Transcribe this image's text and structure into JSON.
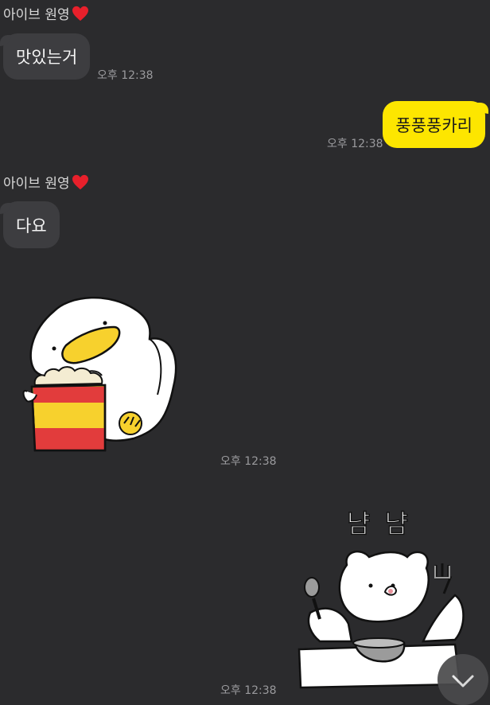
{
  "messages": [
    {
      "sender": "아이브 원영",
      "text": "맛있는거",
      "time": "오후 12:38"
    },
    {
      "text": "풍풍풍카리",
      "time": "오후 12:38"
    },
    {
      "sender": "아이브 원영",
      "text": "다요"
    },
    {
      "sticker": "duck-eating-popcorn-sticker",
      "time": "오후 12:38"
    },
    {
      "sticker": "bear-nyam-nyam-sticker",
      "caption": "냠 냠",
      "time": "오후 12:38"
    }
  ],
  "colors": {
    "background": "#2b2b2d",
    "incoming_bubble": "#3d3d40",
    "outgoing_bubble": "#fde600",
    "timestamp": "#9a9a9d",
    "heart": "#e8202b"
  },
  "icons": {
    "heart": "red-heart-icon",
    "scroll_down": "chevron-down-icon"
  }
}
